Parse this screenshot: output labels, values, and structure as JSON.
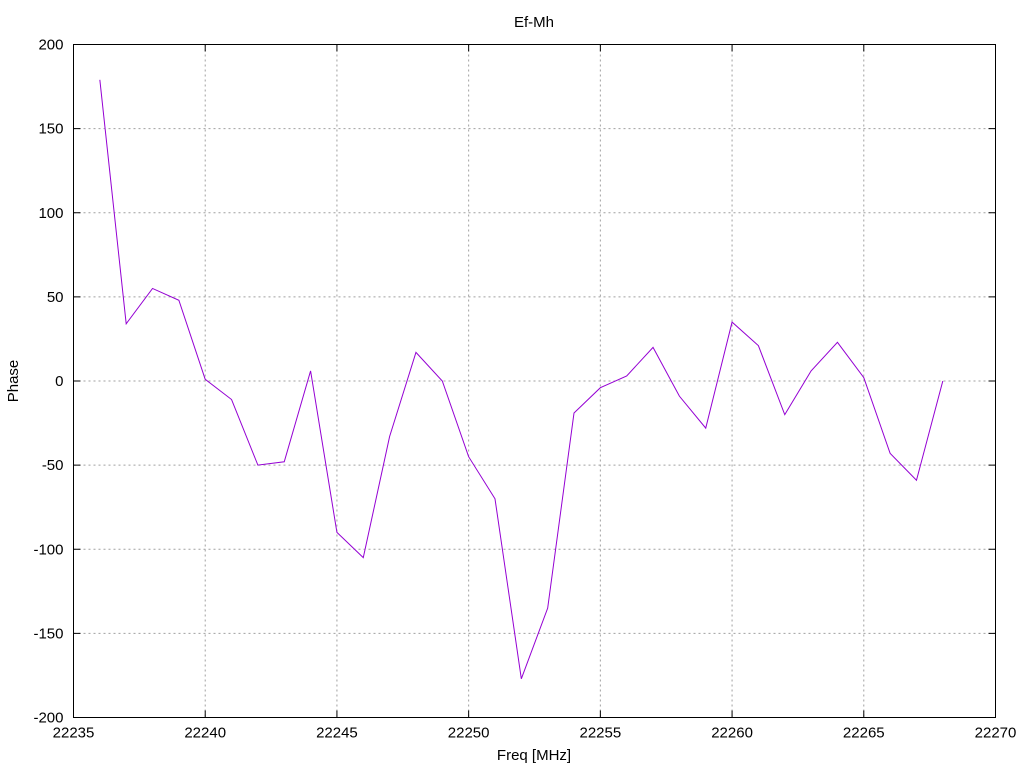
{
  "chart_data": {
    "type": "line",
    "title": "Ef-Mh",
    "xlabel": "Freq [MHz]",
    "ylabel": "Phase",
    "xlim": [
      22235,
      22270
    ],
    "ylim": [
      -200,
      200
    ],
    "xticks": [
      22235,
      22240,
      22245,
      22250,
      22255,
      22260,
      22265,
      22270
    ],
    "yticks": [
      -200,
      -150,
      -100,
      -50,
      0,
      50,
      100,
      150,
      200
    ],
    "grid": true,
    "series": [
      {
        "color": "#9400d3",
        "x": [
          22236,
          22237,
          22238,
          22239,
          22240,
          22241,
          22242,
          22243,
          22244,
          22245,
          22246,
          22247,
          22248,
          22249,
          22250,
          22251,
          22252,
          22253,
          22254,
          22255,
          22256,
          22257,
          22258,
          22259,
          22260,
          22261,
          22262,
          22263,
          22264,
          22265,
          22266,
          22267,
          22268
        ],
        "y": [
          179,
          34,
          55,
          48,
          1,
          -11,
          -50,
          -48,
          6,
          -90,
          -105,
          -33,
          17,
          0,
          -45,
          -70,
          -177,
          -135,
          -19,
          -4,
          3,
          20,
          -9,
          -28,
          35,
          21,
          -20,
          6,
          23,
          2,
          -43,
          -59,
          0
        ]
      }
    ]
  }
}
